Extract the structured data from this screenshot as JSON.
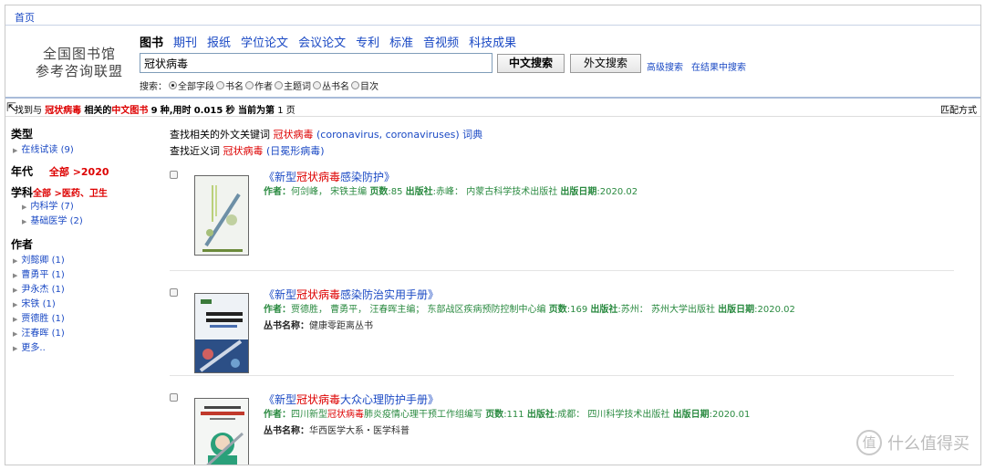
{
  "nav": {
    "home": "首页"
  },
  "logo": {
    "line1": "全国图书馆",
    "line2": "参考咨询联盟"
  },
  "tabs": [
    {
      "label": "图书",
      "active": true
    },
    {
      "label": "期刊",
      "active": false
    },
    {
      "label": "报纸",
      "active": false
    },
    {
      "label": "学位论文",
      "active": false
    },
    {
      "label": "会议论文",
      "active": false
    },
    {
      "label": "专利",
      "active": false
    },
    {
      "label": "标准",
      "active": false
    },
    {
      "label": "音视频",
      "active": false
    },
    {
      "label": "科技成果",
      "active": false
    }
  ],
  "search": {
    "value": "冠状病毒",
    "btn_chinese": "中文搜索",
    "btn_foreign": "外文搜索",
    "advanced": "高级搜索",
    "in_results": "在结果中搜索",
    "fields_label": "搜索：",
    "fields": [
      {
        "label": "全部字段",
        "selected": true
      },
      {
        "label": "书名",
        "selected": false
      },
      {
        "label": "作者",
        "selected": false
      },
      {
        "label": "主题词",
        "selected": false
      },
      {
        "label": "丛书名",
        "selected": false
      },
      {
        "label": "目次",
        "selected": false
      }
    ]
  },
  "summary": {
    "t1": "找到与",
    "keyword": "冠状病毒",
    "t2": "相关的",
    "type": "中文图书",
    "count": "9",
    "t3": "种,用时",
    "time": "0.015",
    "t4": "秒 当前为第",
    "page": "1",
    "t5": "页",
    "match": "匹配方式"
  },
  "sidebar": {
    "type_heading": "类型",
    "type_items": [
      "在线试读 (9)"
    ],
    "year_heading": "年代",
    "year_all": "全部",
    "year_sep": " >",
    "year_value": "2020",
    "subject_heading": "学科",
    "subject_all": "全部",
    "subject_sep": " >",
    "subject_value": "医药、卫生",
    "subject_items": [
      "内科学 (7)",
      "基础医学 (2)"
    ],
    "author_heading": "作者",
    "author_items": [
      "刘懿卿 (1)",
      "曹勇平 (1)",
      "尹永杰 (1)",
      "宋铁 (1)",
      "贾德胜 (1)",
      "汪春晖 (1)",
      "更多.."
    ]
  },
  "related": {
    "foreign_t": "查找相关的外文关键词",
    "foreign_kw": "冠状病毒",
    "foreign_list": "(coronavirus,  coronaviruses)",
    "dict": "词典",
    "syn_t": "查找近义词",
    "syn_kw": "冠状病毒",
    "syn_list": "(日冕形病毒)"
  },
  "labels": {
    "author": "作者：",
    "pages": "页数",
    "publisher_place": "出版社",
    "date": "出版日期",
    "series": "丛书名称："
  },
  "books": [
    {
      "title_pre": "《新型",
      "title_kw": "冠状病毒",
      "title_post": "感染防护》",
      "authors": "何剑峰，  宋铁主编",
      "pages": ":85",
      "place": ":赤峰：  内蒙古科学技术出版社",
      "date": ":2020.02",
      "series": ""
    },
    {
      "title_pre": "《新型",
      "title_kw": "冠状病毒",
      "title_post": "感染防治实用手册》",
      "authors": "贾德胜，  曹勇平，  汪春晖主编；  东部战区疾病预防控制中心编",
      "pages": ":169",
      "place": ":苏州：  苏州大学出版社",
      "date": ":2020.02",
      "series": "健康零距离丛书"
    },
    {
      "title_pre": "《新型",
      "title_kw": "冠状病毒",
      "title_post": "大众心理防护手册》",
      "authors_pre": "四川新型",
      "authors_kw": "冠状病毒",
      "authors_post": "肺炎疫情心理干预工作组编写",
      "pages": ":111",
      "place": ":成都：  四川科学技术出版社",
      "date": ":2020.01",
      "series": "华西医学大系・医学科普"
    }
  ],
  "watermark": {
    "symbol": "值",
    "text": "什么值得买"
  }
}
